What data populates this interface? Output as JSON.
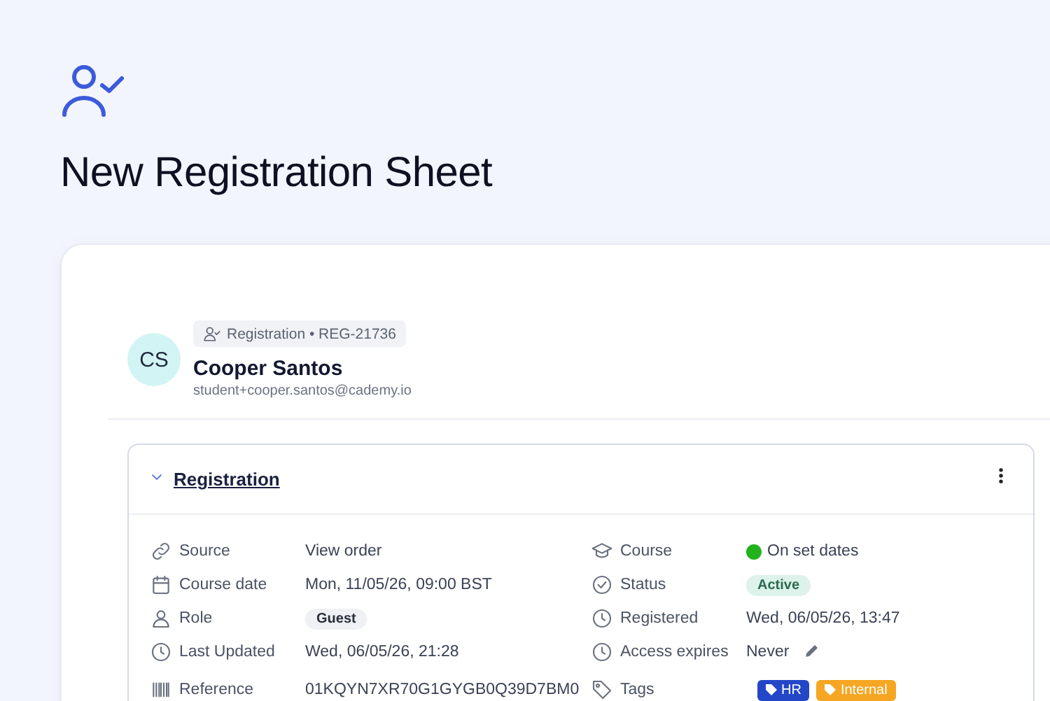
{
  "page": {
    "title": "New Registration Sheet"
  },
  "profile": {
    "initials": "CS",
    "badge": "Registration • REG-21736",
    "name": "Cooper Santos",
    "email": "student+cooper.santos@cademy.io"
  },
  "section": {
    "title": "Registration",
    "expanded": true,
    "left": [
      {
        "label": "Source",
        "kind": "link",
        "value": "View order"
      },
      {
        "label": "Course date",
        "kind": "text",
        "value": "Mon, 11/05/26, 09:00 BST"
      },
      {
        "label": "Role",
        "kind": "pill",
        "value": "Guest"
      },
      {
        "label": "Last Updated",
        "kind": "text",
        "value": "Wed, 06/05/26, 21:28"
      },
      {
        "label": "Reference",
        "kind": "text",
        "value": "01KQYN7XR70G1GYGB0Q39D7BM0"
      }
    ],
    "right": [
      {
        "label": "Course",
        "kind": "dot",
        "value": "On set dates",
        "color": "#22b21c"
      },
      {
        "label": "Status",
        "kind": "status",
        "value": "Active"
      },
      {
        "label": "Registered",
        "kind": "text",
        "value": "Wed, 06/05/26, 13:47"
      },
      {
        "label": "Access expires",
        "kind": "editable",
        "value": "Never"
      },
      {
        "label": "Tags",
        "kind": "tags",
        "tags": [
          {
            "label": "HR",
            "color": "#2447c8"
          },
          {
            "label": "Internal",
            "color": "#f5a623"
          }
        ]
      }
    ]
  }
}
